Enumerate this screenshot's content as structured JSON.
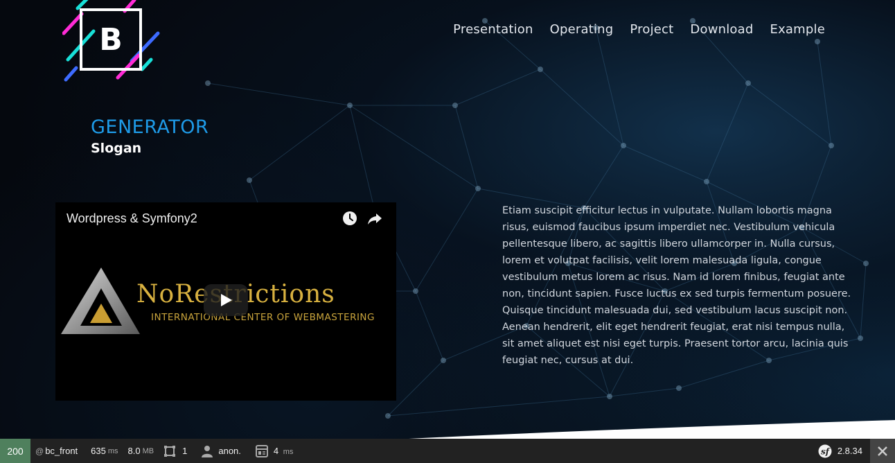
{
  "logo": {
    "letter": "B"
  },
  "nav": {
    "items": [
      "Presentation",
      "Operating",
      "Project",
      "Download",
      "Example"
    ]
  },
  "brand": {
    "title": "GENERATOR",
    "slogan": "Slogan"
  },
  "video": {
    "title": "Wordpress & Symfony2",
    "thumbnail_main": "NoRestrictions",
    "thumbnail_sub": "INTERNATIONAL CENTER OF WEBMASTERING",
    "icons": [
      "clock-icon",
      "share-icon",
      "play-icon"
    ]
  },
  "body_text": "Etiam suscipit efficitur lectus in vulputate. Nullam lobortis magna risus, euismod faucibus ipsum imperdiet nec. Vestibulum vehicula pellentesque libero, ac sagittis libero ullamcorper in. Nulla cursus, lorem et volutpat facilisis, velit lorem malesuada ligula, congue vestibulum metus lorem ac risus. Nam id lorem finibus, feugiat ante non, tincidunt sapien. Fusce luctus ex sed turpis fermentum posuere. Quisque tincidunt malesuada dui, sed vestibulum lacus suscipit non. Aenean hendrerit, elit eget hendrerit feugiat, erat nisi tempus nulla, sit amet aliquet est nisi eget turpis. Praesent tortor arcu, lacinia quis feugiat nec, cursus at dui.",
  "debug_toolbar": {
    "status": "200",
    "route_prefix": "@",
    "route": "bc_front",
    "time_value": "635",
    "time_unit": "ms",
    "memory_value": "8.0",
    "memory_unit": "MB",
    "forms_count": "1",
    "user": "anon.",
    "twig_value": "4",
    "twig_unit": "ms",
    "version": "2.8.34"
  },
  "colors": {
    "brand_title": "#1e9be8",
    "toolbar_bg": "#222222",
    "status_ok": "#4f805d",
    "thumbnail_gold": "#d8b140"
  }
}
